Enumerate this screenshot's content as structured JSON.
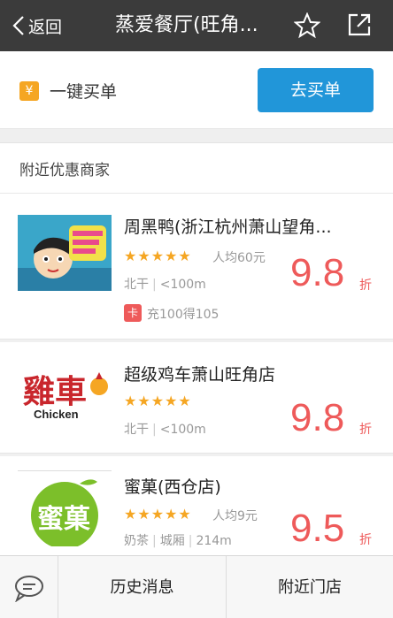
{
  "nav": {
    "back_label": "返回",
    "title": "蒸爱餐厅(旺角...",
    "star_icon": "star-outline-icon",
    "share_icon": "share-external-icon"
  },
  "buybar": {
    "icon_glyph": "¥",
    "label": "一键买单",
    "button_label": "去买单",
    "button_color": "#2196d9"
  },
  "section": {
    "title": "附近优惠商家"
  },
  "merchants": [
    {
      "name": "周黑鸭(浙江杭州萧山望角...",
      "stars": "★★★★★",
      "avg": "人均60元",
      "area": "北干",
      "distance": "<100m",
      "price": "9.8",
      "unit": "折",
      "promo_icon": "卡",
      "promo": "充100得105"
    },
    {
      "name": "超级鸡车萧山旺角店",
      "stars": "★★★★★",
      "area": "北干",
      "distance": "<100m",
      "price": "9.8",
      "unit": "折",
      "logo_text": "雞車",
      "logo_sub": "Chicken"
    },
    {
      "name": "蜜菓(西仓店)",
      "stars": "★★★★★",
      "avg": "人均9元",
      "category": "奶茶",
      "area": "城厢",
      "distance": "214m",
      "price": "9.5",
      "unit": "折",
      "logo_text": "蜜菓"
    }
  ],
  "bottombar": {
    "chat_icon": "chat-bubble-icon",
    "history_label": "历史消息",
    "nearby_label": "附近门店"
  },
  "colors": {
    "price_red": "#ee5a5a",
    "star_orange": "#f5a623",
    "nav_bg": "#3b3b3b"
  }
}
